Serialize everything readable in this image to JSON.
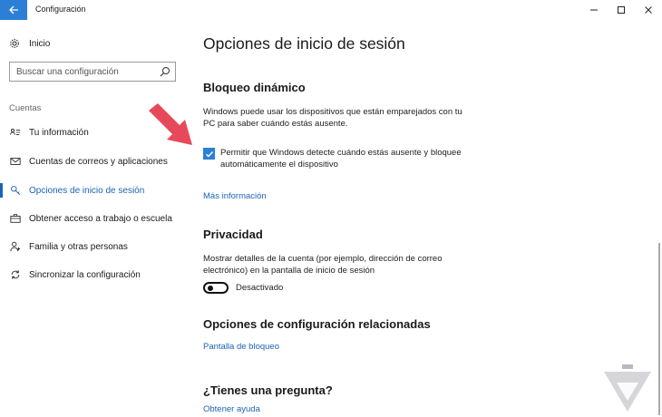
{
  "window": {
    "title": "Configuración"
  },
  "sidebar": {
    "home_label": "Inicio",
    "search_placeholder": "Buscar una configuración",
    "section_label": "Cuentas",
    "items": [
      {
        "label": "Tu información",
        "icon": "person-card-icon"
      },
      {
        "label": "Cuentas de correos y aplicaciones",
        "icon": "mail-icon"
      },
      {
        "label": "Opciones de inicio de sesión",
        "icon": "key-icon",
        "active": true
      },
      {
        "label": "Obtener acceso a trabajo o escuela",
        "icon": "briefcase-icon"
      },
      {
        "label": "Familia y otras personas",
        "icon": "person-add-icon"
      },
      {
        "label": "Sincronizar la configuración",
        "icon": "sync-icon"
      }
    ]
  },
  "main": {
    "page_title": "Opciones de inicio de sesión",
    "dynamic_lock": {
      "heading": "Bloqueo dinámico",
      "description_line1": "Windows puede usar los dispositivos que están emparejados con tu",
      "description_line2": "PC para saber cuándo estás ausente.",
      "checkbox_line1": "Permitir que Windows detecte cuándo estás ausente y bloquee",
      "checkbox_line2": "automáticamente el dispositivo",
      "checkbox_checked": true,
      "more_info_link": "Más información"
    },
    "privacy": {
      "heading": "Privacidad",
      "description_line1": "Mostrar detalles de la cuenta (por ejemplo, dirección de correo",
      "description_line2": "electrónico) en la pantalla de inicio de sesión",
      "toggle_label": "Desactivado",
      "toggle_on": false
    },
    "related": {
      "heading": "Opciones de configuración relacionadas",
      "link": "Pantalla de bloqueo"
    },
    "question": {
      "heading": "¿Tienes una pregunta?",
      "link": "Obtener ayuda"
    }
  },
  "colors": {
    "accent": "#1c63b5",
    "titlebar_back": "#2b7fd6",
    "arrow": "#e8495a"
  }
}
